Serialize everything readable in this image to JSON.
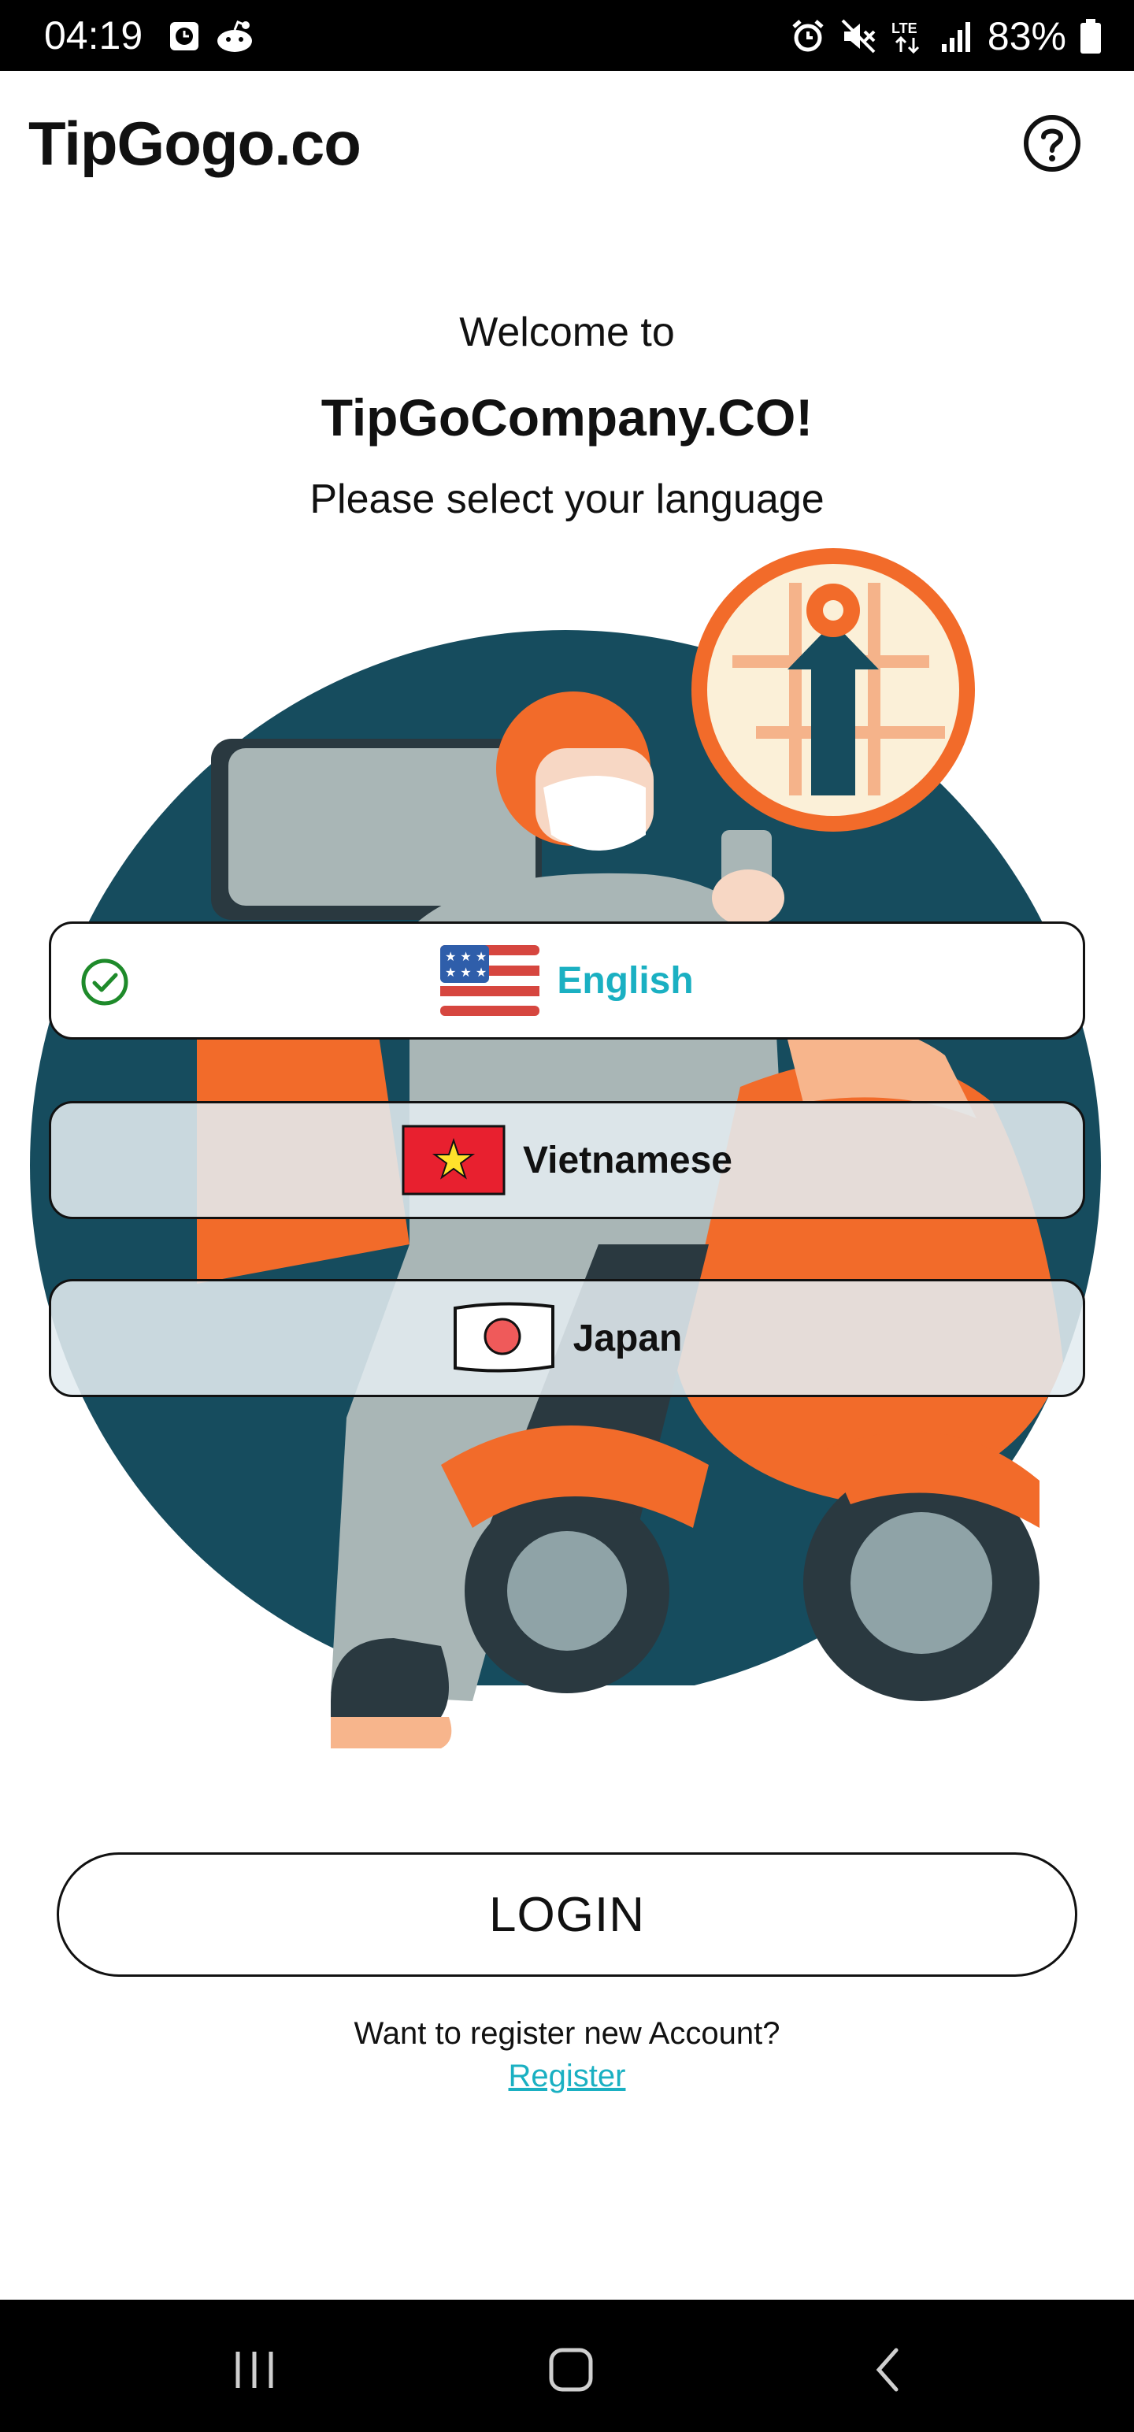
{
  "status_bar": {
    "time": "04:19",
    "battery": "83%",
    "network": "LTE",
    "icons": [
      "clock-app-icon",
      "reddit-icon",
      "alarm-icon",
      "mute-icon",
      "lte-icon",
      "signal-icon",
      "battery-icon"
    ]
  },
  "app_bar": {
    "title": "TipGogo.co",
    "help_icon": "help-circle-icon"
  },
  "welcome": {
    "line1": "Welcome to",
    "line2": "TipGoCompany.CO!",
    "line3": "Please select your language"
  },
  "languages": [
    {
      "label": "English",
      "flag": "us-flag-icon",
      "selected": true
    },
    {
      "label": "Vietnamese",
      "flag": "vietnam-flag-icon",
      "selected": false
    },
    {
      "label": "Japan",
      "flag": "japan-flag-icon",
      "selected": false
    }
  ],
  "login": {
    "label": "LOGIN"
  },
  "register": {
    "question": "Want to register new Account?",
    "link": "Register"
  },
  "colors": {
    "accent": "#1ab0c2",
    "check": "#1e8a2a",
    "illustration_circle": "#164c5e",
    "scooter_orange": "#f26b2a"
  },
  "nav_bar": {
    "icons": [
      "recent-apps-icon",
      "home-icon",
      "back-icon"
    ]
  }
}
